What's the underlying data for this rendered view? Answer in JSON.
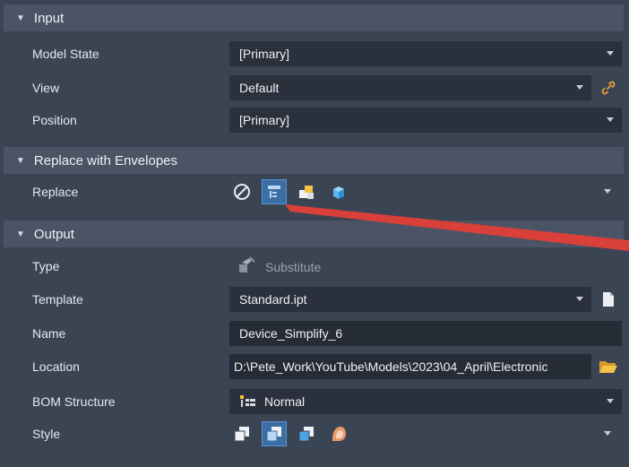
{
  "sections": {
    "input": "Input",
    "replace": "Replace with Envelopes",
    "output": "Output"
  },
  "input": {
    "model_state_label": "Model State",
    "model_state_value": "[Primary]",
    "view_label": "View",
    "view_value": "Default",
    "position_label": "Position",
    "position_value": "[Primary]"
  },
  "replace": {
    "label": "Replace",
    "icons": [
      "none-icon",
      "tree-filter-icon",
      "parts-icon",
      "envelope-box-icon"
    ],
    "active_index": 1
  },
  "output": {
    "type_label": "Type",
    "type_value": "Substitute",
    "template_label": "Template",
    "template_value": "Standard.ipt",
    "name_label": "Name",
    "name_value": "Device_Simplify_6",
    "location_label": "Location",
    "location_value": "D:\\Pete_Work\\YouTube\\Models\\2023\\04_April\\Electronic",
    "bom_label": "BOM Structure",
    "bom_value": "Normal",
    "style_label": "Style",
    "style_icons": [
      "style-single-solid-icon",
      "style-solid-per-body-icon",
      "style-maintain-seams-icon",
      "style-single-composite-icon"
    ],
    "style_active_index": 1
  },
  "colors": {
    "background": "#3b4453",
    "header": "#4a5464",
    "field": "#2a313c",
    "accent": "#3a6ea5",
    "annotation": "#d9403a"
  }
}
